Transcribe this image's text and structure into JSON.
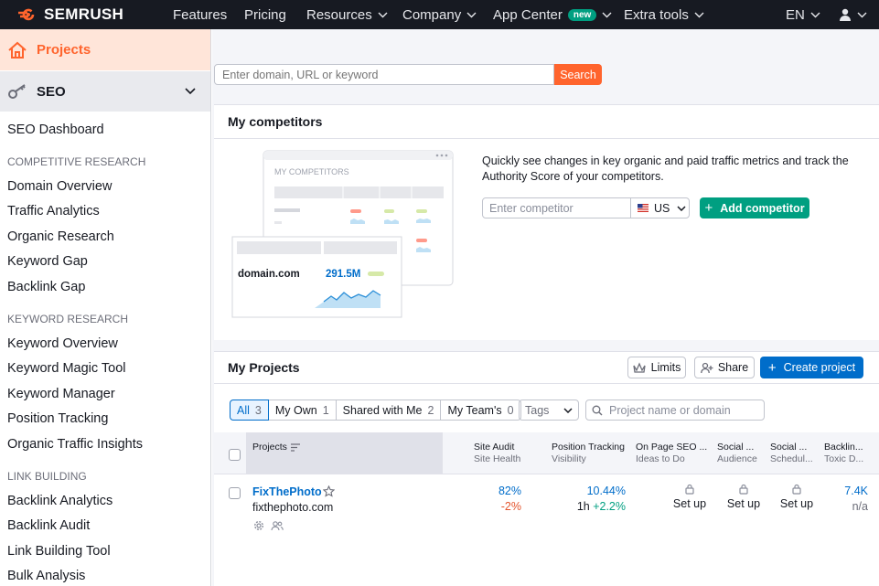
{
  "topnav": {
    "logo": "SEMRUSH",
    "items": [
      {
        "label": "Features",
        "chevron": false
      },
      {
        "label": "Pricing",
        "chevron": false
      },
      {
        "label": "Resources",
        "chevron": true
      },
      {
        "label": "Company",
        "chevron": true
      },
      {
        "label": "App Center",
        "chevron": true,
        "badge": "new"
      },
      {
        "label": "Extra tools",
        "chevron": true
      }
    ],
    "lang": "EN"
  },
  "sidebar": {
    "projects": "Projects",
    "seo": "SEO",
    "dashboard": "SEO Dashboard",
    "sections": [
      {
        "title": "COMPETITIVE RESEARCH",
        "links": [
          "Domain Overview",
          "Traffic Analytics",
          "Organic Research",
          "Keyword Gap",
          "Backlink Gap"
        ]
      },
      {
        "title": "KEYWORD RESEARCH",
        "links": [
          "Keyword Overview",
          "Keyword Magic Tool",
          "Keyword Manager",
          "Position Tracking",
          "Organic Traffic Insights"
        ]
      },
      {
        "title": "LINK BUILDING",
        "links": [
          "Backlink Analytics",
          "Backlink Audit",
          "Link Building Tool",
          "Bulk Analysis"
        ]
      }
    ]
  },
  "search": {
    "placeholder": "Enter domain, URL or keyword",
    "button": "Search"
  },
  "competitors": {
    "title": "My competitors",
    "illus_label": "MY COMPETITORS",
    "illus_domain": "domain.com",
    "illus_value": "291.5M",
    "description": "Quickly see changes in key organic and paid traffic metrics and track the Authority Score of your competitors.",
    "input_placeholder": "Enter competitor",
    "country": "US",
    "add_button": "Add competitor"
  },
  "projects": {
    "title": "My Projects",
    "limits": "Limits",
    "share": "Share",
    "create": "Create project",
    "filters": [
      {
        "label": "All",
        "count": "3"
      },
      {
        "label": "My Own",
        "count": "1"
      },
      {
        "label": "Shared with Me",
        "count": "2"
      },
      {
        "label": "My Team's",
        "count": "0"
      }
    ],
    "tags": "Tags",
    "search_placeholder": "Project name or domain",
    "columns": {
      "projects": "Projects",
      "site_audit_1": "Site Audit",
      "site_audit_2": "Site Health",
      "pos_1": "Position Tracking",
      "pos_2": "Visibility",
      "onpage_1": "On Page SEO ...",
      "onpage_2": "Ideas to Do",
      "social1_1": "Social ...",
      "social1_2": "Audience",
      "social2_1": "Social ...",
      "social2_2": "Schedul...",
      "backl_1": "Backlin...",
      "backl_2": "Toxic D..."
    },
    "row": {
      "name": "FixThePhoto",
      "domain": "fixthephoto.com",
      "site_health": "82%",
      "site_change": "-2%",
      "visibility": "10.44%",
      "vis_period": "1h",
      "vis_change": "+2.2%",
      "setup": "Set up",
      "toxic": "7.4K",
      "toxic_sub": "n/a"
    }
  }
}
